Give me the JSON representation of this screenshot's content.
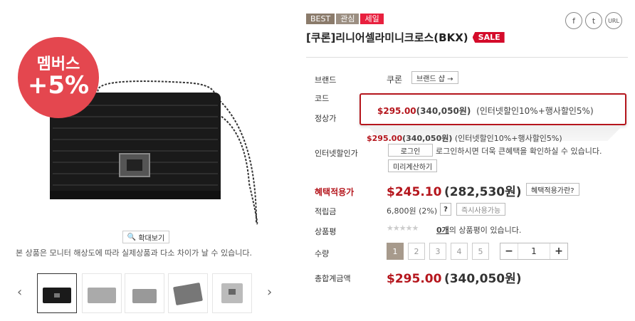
{
  "badge": {
    "line1": "멤버스",
    "line2": "+5%"
  },
  "gallery": {
    "zoom_label": "확대보기",
    "disclaimer": "본 상품은 모니터 해상도에 따라 실제상품과 다소 차이가 날 수 있습니다."
  },
  "tags": {
    "best": "BEST",
    "gwansim": "관심",
    "sale": "세일"
  },
  "product": {
    "title": "[쿠론]리니어셀라미니크로스(BKX)",
    "sale_badge": "SALE"
  },
  "social": {
    "facebook": "f",
    "twitter": "t",
    "url": "URL"
  },
  "info": {
    "brand_label": "브랜드",
    "brand_value": "쿠론",
    "brand_shop_btn": "브랜드 샵 →",
    "code_label": "코드",
    "regular_label": "정상가",
    "regular_price_usd": "$295.00",
    "regular_price_krw": "(340,050원)",
    "regular_discount_note": "(인터넷할인10%+행사할인5%)",
    "internet_label": "인터넷할인가",
    "internet_price_usd": "$295.00",
    "internet_price_krw": "(340,050원)",
    "internet_discount_note": "(인터넷할인10%+행사할인5%)",
    "login_btn": "로그인",
    "login_msg": "로그인하시면 더욱 큰혜택을 확인하실 수 있습니다.",
    "precalc_btn": "미리계산하기",
    "benefit_label": "혜택적용가",
    "benefit_price_usd": "$245.10",
    "benefit_price_krw": "(282,530원)",
    "benefit_help_btn": "혜택적용가란?",
    "points_label": "적립금",
    "points_value": "6,800원 (2%)",
    "points_q": "?",
    "points_btn": "즉시사용가능",
    "review_label": "상품평",
    "review_stars": "★★★★★",
    "review_count": "0개",
    "review_msg": "의 상품평이 있습니다.",
    "qty_label": "수량",
    "qty_options": [
      "1",
      "2",
      "3",
      "4",
      "5"
    ],
    "qty_minus": "−",
    "qty_value": "1",
    "qty_plus": "+",
    "total_label": "총합계금액",
    "total_usd": "$295.00",
    "total_krw": "(340,050원)"
  },
  "colors": {
    "accent_red": "#b5161d",
    "badge_red": "#e4474f",
    "qty_selected": "#a79a8c"
  }
}
